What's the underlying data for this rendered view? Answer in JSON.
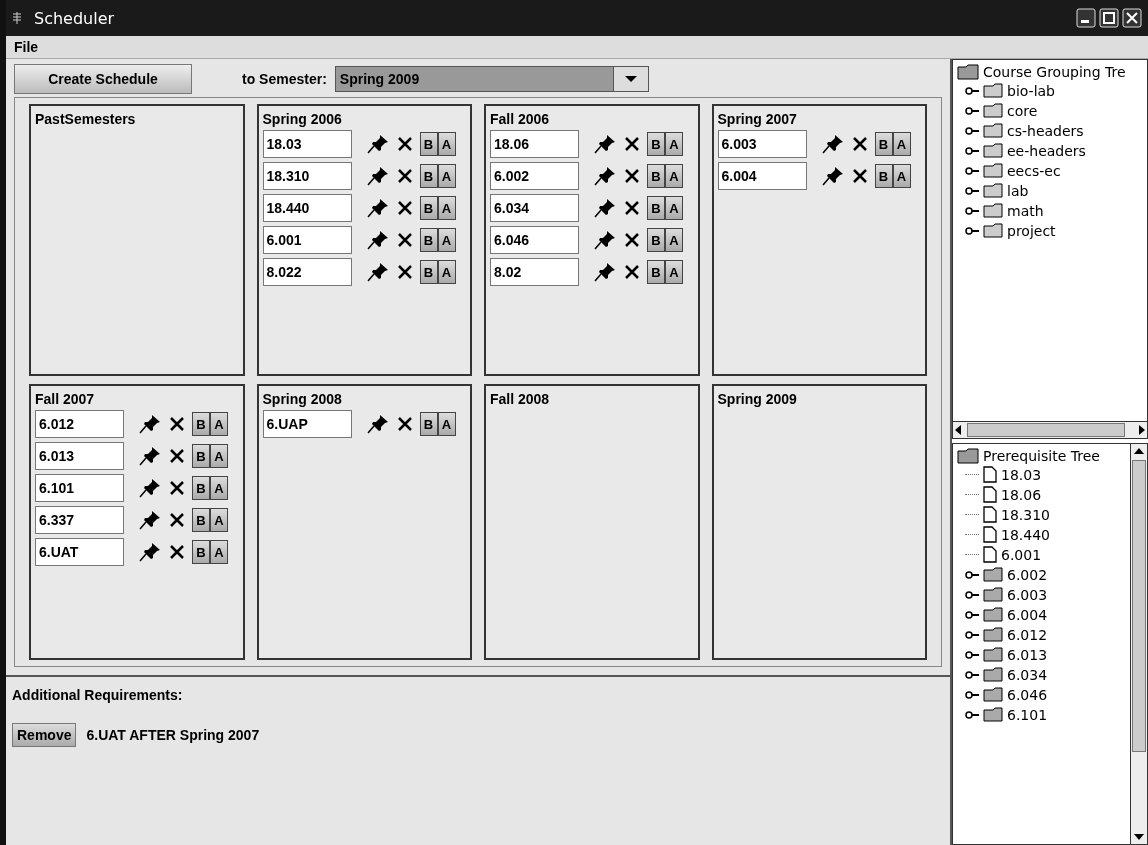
{
  "window": {
    "title": "Scheduler"
  },
  "menu": [
    "File"
  ],
  "toolbar": {
    "create_button": "Create Schedule",
    "target_label": "to Semester:",
    "target_value": "Spring 2009"
  },
  "semesters": [
    {
      "name": "PastSemesters"
    },
    {
      "name": "Spring 2006",
      "courses": [
        {
          "code": "18.03",
          "before": "B",
          "after": "A"
        },
        {
          "code": "18.310",
          "before": "B",
          "after": "A"
        },
        {
          "code": "18.440",
          "before": "B",
          "after": "A"
        },
        {
          "code": "6.001",
          "before": "B",
          "after": "A"
        },
        {
          "code": "8.022",
          "before": "B",
          "after": "A"
        }
      ]
    },
    {
      "name": "Fall 2006",
      "courses": [
        {
          "code": "18.06",
          "before": "B",
          "after": "A"
        },
        {
          "code": "6.002",
          "before": "B",
          "after": "A"
        },
        {
          "code": "6.034",
          "before": "B",
          "after": "A"
        },
        {
          "code": "6.046",
          "before": "B",
          "after": "A"
        },
        {
          "code": "8.02",
          "before": "B",
          "after": "A"
        }
      ]
    },
    {
      "name": "Spring 2007",
      "courses": [
        {
          "code": "6.003",
          "before": "B",
          "after": "A"
        },
        {
          "code": "6.004",
          "before": "B",
          "after": "A"
        }
      ]
    },
    {
      "name": "Fall 2007",
      "courses": [
        {
          "code": "6.012",
          "before": "B",
          "after": "A"
        },
        {
          "code": "6.013",
          "before": "B",
          "after": "A"
        },
        {
          "code": "6.101",
          "before": "B",
          "after": "A"
        },
        {
          "code": "6.337",
          "before": "B",
          "after": "A"
        },
        {
          "code": "6.UAT",
          "before": "B",
          "after": "A"
        }
      ]
    },
    {
      "name": "Spring 2008",
      "courses": [
        {
          "code": "6.UAP",
          "before": "B",
          "after": "A"
        }
      ]
    },
    {
      "name": "Fall 2008"
    },
    {
      "name": "Spring 2009"
    }
  ],
  "requirements": {
    "title": "Additional Requirements:",
    "items": [
      {
        "button": "Remove",
        "text": "6.UAT AFTER Spring 2007"
      }
    ]
  },
  "grouping_tree": {
    "root": "Course Grouping Tre",
    "items": [
      {
        "label": "bio-lab",
        "kind": "folder",
        "expanded": false
      },
      {
        "label": "core",
        "kind": "folder",
        "expanded": false
      },
      {
        "label": "cs-headers",
        "kind": "folder",
        "expanded": false
      },
      {
        "label": "ee-headers",
        "kind": "folder",
        "expanded": false
      },
      {
        "label": "eecs-ec",
        "kind": "folder",
        "expanded": false
      },
      {
        "label": "lab",
        "kind": "folder",
        "expanded": false
      },
      {
        "label": "math",
        "kind": "folder",
        "expanded": false
      },
      {
        "label": "project",
        "kind": "folder",
        "expanded": false
      }
    ]
  },
  "prerequisite_tree": {
    "root": "Prerequisite Tree",
    "items": [
      {
        "label": "18.03",
        "kind": "leaf"
      },
      {
        "label": "18.06",
        "kind": "leaf"
      },
      {
        "label": "18.310",
        "kind": "leaf"
      },
      {
        "label": "18.440",
        "kind": "leaf"
      },
      {
        "label": "6.001",
        "kind": "leaf"
      },
      {
        "label": "6.002",
        "kind": "folder",
        "expanded": false
      },
      {
        "label": "6.003",
        "kind": "folder",
        "expanded": false
      },
      {
        "label": "6.004",
        "kind": "folder",
        "expanded": false
      },
      {
        "label": "6.012",
        "kind": "folder",
        "expanded": false
      },
      {
        "label": "6.013",
        "kind": "folder",
        "expanded": false
      },
      {
        "label": "6.034",
        "kind": "folder",
        "expanded": false
      },
      {
        "label": "6.046",
        "kind": "folder",
        "expanded": false
      },
      {
        "label": "6.101",
        "kind": "folder",
        "expanded": false
      }
    ]
  }
}
